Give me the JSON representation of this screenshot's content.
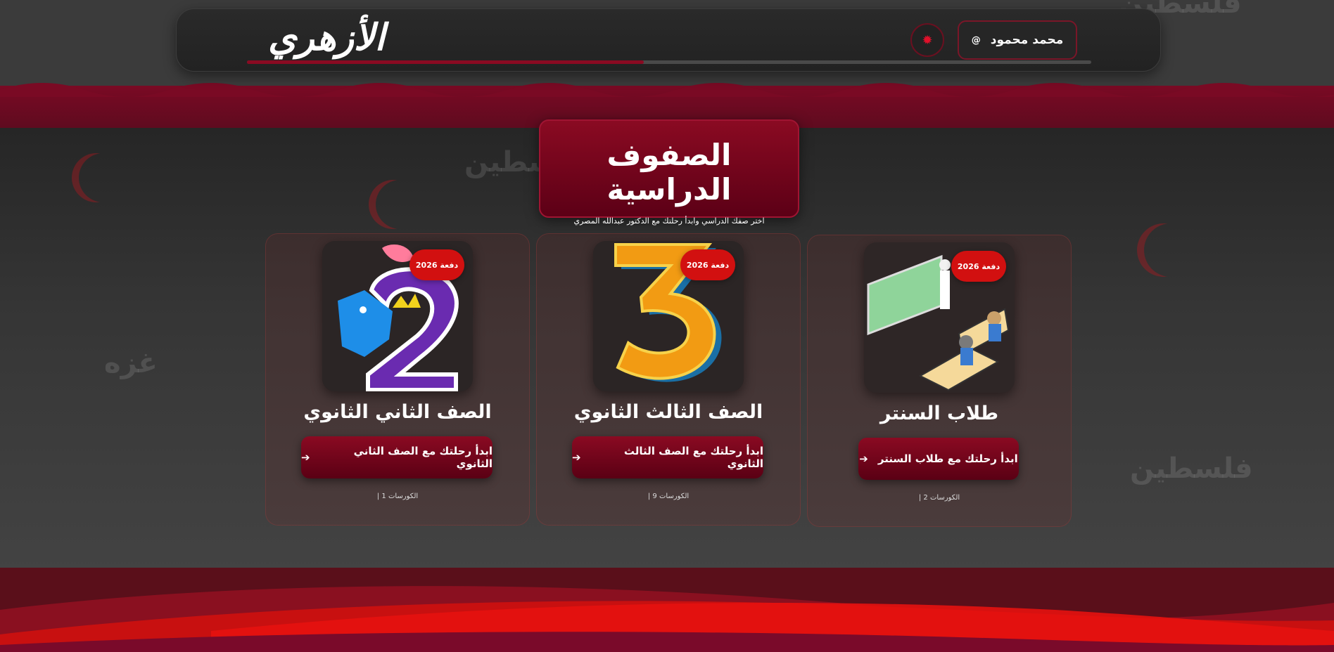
{
  "header": {
    "logo_text": "الأزهري",
    "user_name": "محمد محمود",
    "user_icon": "@",
    "settings_icon": "✹",
    "progress_percent": 47
  },
  "section": {
    "title": "الصفوف الدراسية",
    "subtitle": "اختر صفك الدراسي وابدأ رحلتك مع الدكتور عبدالله المصري"
  },
  "watermarks": [
    "فلسطين",
    "غزه",
    "فلسطين",
    "فلسطين"
  ],
  "cards": [
    {
      "badge": "دفعة 2026",
      "title": "الصف الثاني الثانوي",
      "button_label": "ابدأ رحلتك مع الصف الثاني الثانوي",
      "count_label": "الكورسات 1 |",
      "image_icon": "number-two-illustration-icon"
    },
    {
      "badge": "دفعة 2026",
      "title": "الصف الثالث الثانوي",
      "button_label": "ابدأ رحلتك مع الصف الثالث الثانوي",
      "count_label": "الكورسات 9 |",
      "image_icon": "number-three-illustration-icon"
    },
    {
      "badge": "دفعة 2026",
      "title": "طلاب السنتر",
      "button_label": "ابدأ رحلتك مع طلاب السنتر",
      "count_label": "الكورسات 2 |",
      "image_icon": "classroom-illustration-icon"
    }
  ],
  "colors": {
    "accent": "#8a0a22",
    "badge": "#d21010"
  }
}
